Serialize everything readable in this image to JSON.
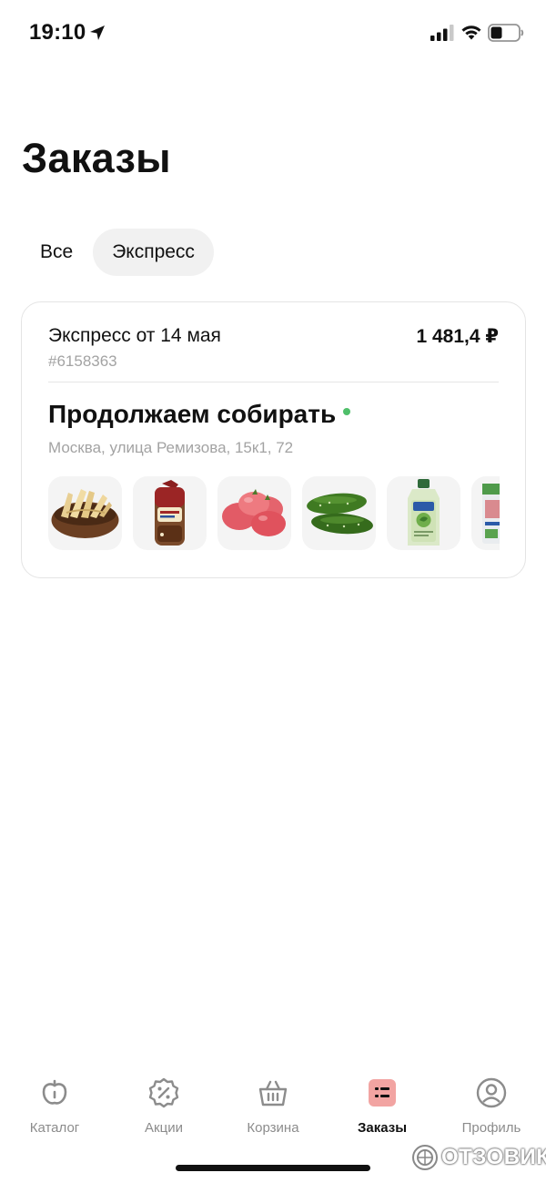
{
  "status_bar": {
    "time": "19:10"
  },
  "page": {
    "title": "Заказы"
  },
  "tabs": [
    {
      "label": "Все",
      "selected": false
    },
    {
      "label": "Экспресс",
      "selected": true
    }
  ],
  "order": {
    "title": "Экспресс от 14 мая",
    "price": "1 481,4 ₽",
    "number": "#6158363",
    "status": "Продолжаем собирать",
    "status_color": "#4fbf6a",
    "address": "Москва, улица Ремизова, 15к1, 72",
    "products": [
      {
        "name": "dried-fish-snack-icon"
      },
      {
        "name": "bread-loaf-icon"
      },
      {
        "name": "tomatoes-icon"
      },
      {
        "name": "cucumbers-icon"
      },
      {
        "name": "detergent-bottle-icon"
      },
      {
        "name": "packaged-product-icon"
      }
    ]
  },
  "tab_bar": {
    "items": [
      {
        "label": "Каталог",
        "icon": "apple-icon",
        "active": false
      },
      {
        "label": "Акции",
        "icon": "discount-badge-icon",
        "active": false
      },
      {
        "label": "Корзина",
        "icon": "basket-icon",
        "active": false
      },
      {
        "label": "Заказы",
        "icon": "orders-list-icon",
        "active": true
      },
      {
        "label": "Профиль",
        "icon": "profile-icon",
        "active": false
      }
    ],
    "active_color": "#f2a4a2"
  },
  "watermark": {
    "text": "ОТЗОВИК"
  }
}
